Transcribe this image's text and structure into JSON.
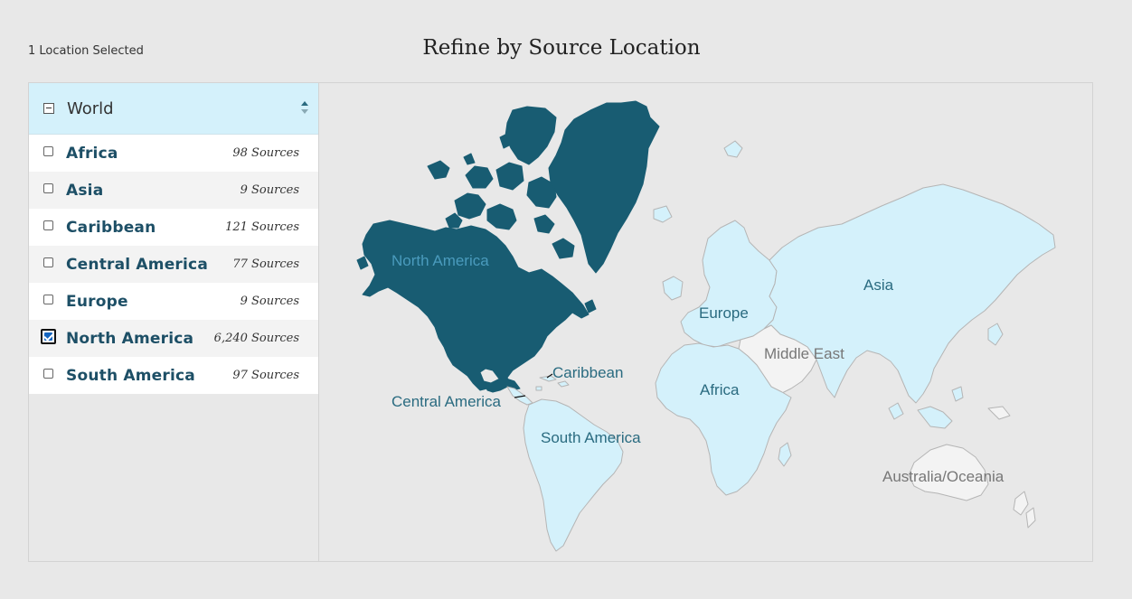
{
  "header": {
    "selected_count": "1 Location Selected",
    "title": "Refine by Source Location"
  },
  "sidebar": {
    "world_label": "World",
    "regions": [
      {
        "name": "Africa",
        "count": "98 Sources",
        "checked": false
      },
      {
        "name": "Asia",
        "count": "9 Sources",
        "checked": false
      },
      {
        "name": "Caribbean",
        "count": "121 Sources",
        "checked": false
      },
      {
        "name": "Central America",
        "count": "77 Sources",
        "checked": false
      },
      {
        "name": "Europe",
        "count": "9 Sources",
        "checked": false
      },
      {
        "name": "North America",
        "count": "6,240 Sources",
        "checked": true
      },
      {
        "name": "South America",
        "count": "97 Sources",
        "checked": false
      }
    ]
  },
  "map": {
    "labels": {
      "north_america": "North America",
      "caribbean": "Caribbean",
      "central_america": "Central America",
      "south_america": "South America",
      "europe": "Europe",
      "africa": "Africa",
      "asia": "Asia",
      "middle_east": "Middle East",
      "australia_oceania": "Australia/Oceania"
    },
    "colors": {
      "selected": "#185c72",
      "available": "#d4f1fb",
      "unavailable": "#f3f3f3",
      "border": "#b5b5b5",
      "label_available": "#2a6b80",
      "label_unavailable": "#777777"
    }
  }
}
